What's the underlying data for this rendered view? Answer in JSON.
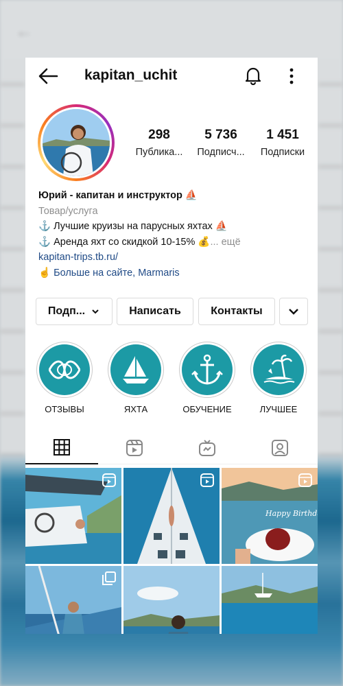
{
  "header": {
    "username": "kapitan_uchit"
  },
  "profile": {
    "stats": [
      {
        "value": "298",
        "label": "Публика..."
      },
      {
        "value": "5 736",
        "label": "Подписч..."
      },
      {
        "value": "1 451",
        "label": "Подписки"
      }
    ],
    "bio": {
      "name": "Юрий - капитан и инструктор ⛵",
      "category": "Товар/услуга",
      "line1": "⚓ Лучшие круизы на парусных яхтах ⛵",
      "line2": "⚓ Аренда яхт со скидкой 10-15% 💰",
      "more": "... ещё",
      "link": "kapitan-trips.tb.ru/",
      "website": "☝ Больше на сайте, Marmaris"
    }
  },
  "buttons": {
    "follow": "Подп...",
    "message": "Написать",
    "contacts": "Контакты"
  },
  "highlights": [
    {
      "label": "ОТЗЫВЫ",
      "icon": "knot-icon"
    },
    {
      "label": "ЯХТА",
      "icon": "sailboat-icon"
    },
    {
      "label": "ОБУЧЕНИЕ",
      "icon": "anchor-icon"
    },
    {
      "label": "ЛУЧШЕЕ",
      "icon": "island-icon"
    }
  ],
  "tabs": [
    {
      "name": "grid-icon",
      "active": true
    },
    {
      "name": "reels-icon",
      "active": false
    },
    {
      "name": "igtv-icon",
      "active": false
    },
    {
      "name": "tagged-icon",
      "active": false
    }
  ],
  "posts": [
    {
      "badge": "reels-icon"
    },
    {
      "badge": "reels-icon"
    },
    {
      "badge": "reels-icon"
    },
    {
      "badge": "carousel-icon"
    },
    {
      "badge": ""
    },
    {
      "badge": ""
    }
  ],
  "post_texts": {
    "cake": "Happy Birthday"
  },
  "colors": {
    "highlight": "#1c9aa5",
    "link": "#1f4a86",
    "category": "#8e8e8e"
  }
}
